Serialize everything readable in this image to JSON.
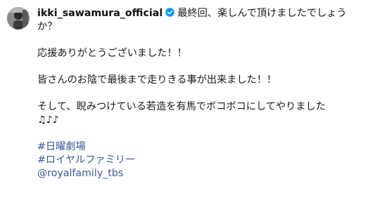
{
  "post": {
    "username": "ikki_sawamura_official",
    "verified_icon": "verified-badge-icon",
    "caption_first": "最終回、楽しんで頂けましたでしょう",
    "caption_wrap": "か？",
    "lines": [
      "応援ありがとうございました！！",
      "皆さんのお陰で最後まで走りきる事が出来ました！！",
      "そして、睨みつけている若造を有馬でボコボコにしてやりました",
      "♫♪♪"
    ],
    "hashtags": [
      "#日曜劇場",
      "#ロイヤルファミリー"
    ],
    "mention": "@royalfamily_tbs",
    "colors": {
      "link": "#385898",
      "verified": "#0095f6",
      "text": "#1a1a1a"
    }
  }
}
